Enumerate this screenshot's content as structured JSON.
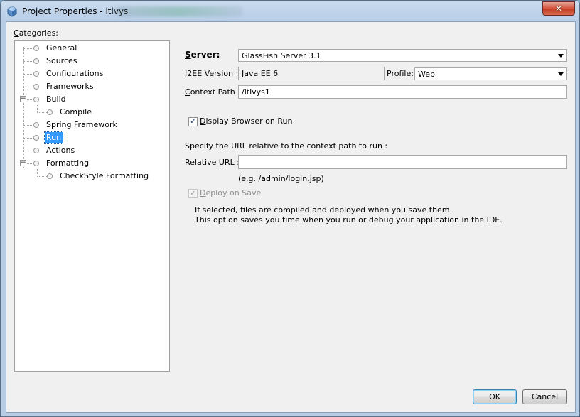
{
  "window": {
    "title": "Project Properties - itivys",
    "close_glyph": "✕"
  },
  "categories": {
    "label_prefix": "C",
    "label_rest": "ategories:",
    "items": [
      {
        "label": "General"
      },
      {
        "label": "Sources"
      },
      {
        "label": "Configurations"
      },
      {
        "label": "Frameworks"
      },
      {
        "label": "Build",
        "expanded": true
      },
      {
        "label": "Compile"
      },
      {
        "label": "Spring Framework"
      },
      {
        "label": "Run",
        "selected": true
      },
      {
        "label": "Actions"
      },
      {
        "label": "Formatting",
        "expanded": true
      },
      {
        "label": "CheckStyle Formatting"
      }
    ]
  },
  "run": {
    "server_label_u": "S",
    "server_label_rest": "erver:",
    "server_value": "GlassFish Server 3.1",
    "j2ee_label_a": "J2EE ",
    "j2ee_label_u": "V",
    "j2ee_label_b": "ersion :",
    "j2ee_value": "Java EE 6",
    "profile_label_u": "P",
    "profile_label_rest": "rofile:",
    "profile_value": "Web",
    "context_label_u": "C",
    "context_label_rest": "ontext Path :",
    "context_value": "/itivys1",
    "display_browser_u": "D",
    "display_browser_rest": "isplay Browser on Run",
    "display_browser_checked": true,
    "url_hint": "Specify the URL relative to the context path to run :",
    "relative_label_a": "Relative ",
    "relative_label_u": "U",
    "relative_label_b": "RL :",
    "relative_value": "",
    "relative_example": "(e.g. /admin/login.jsp)",
    "deploy_u": "D",
    "deploy_rest": "eploy on Save",
    "deploy_checked": true,
    "deploy_note_1": "If selected, files are compiled and deployed when you save them.",
    "deploy_note_2": "This option saves you time when you run or debug your application in the IDE."
  },
  "buttons": {
    "ok": "OK",
    "cancel": "Cancel"
  },
  "glyphs": {
    "check": "✓",
    "minus": "−"
  }
}
